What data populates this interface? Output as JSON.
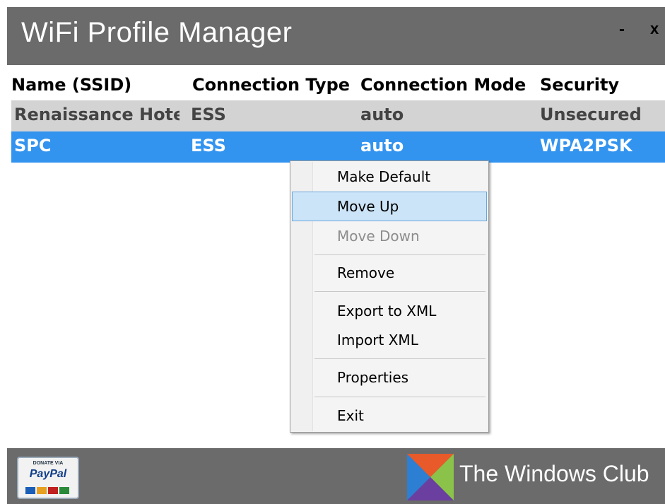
{
  "window": {
    "title": "WiFi Profile Manager",
    "minimize_label": "-",
    "close_label": "x"
  },
  "table": {
    "headers": [
      "Name (SSID)",
      "Connection Type",
      "Connection Mode",
      "Security"
    ],
    "rows": [
      [
        "Renaissance Hotel",
        "ESS",
        "auto",
        "Unsecured"
      ],
      [
        "SPC",
        "ESS",
        "auto",
        "WPA2PSK"
      ]
    ],
    "selected_row": 1
  },
  "context_menu": {
    "items": [
      {
        "label": "Make Default",
        "enabled": true
      },
      {
        "label": "Move Up",
        "enabled": true,
        "highlighted": true
      },
      {
        "label": "Move Down",
        "enabled": false
      },
      {
        "label": "Remove",
        "enabled": true
      },
      {
        "label": "Export to XML",
        "enabled": true
      },
      {
        "label": "Import XML",
        "enabled": true
      },
      {
        "label": "Properties",
        "enabled": true
      },
      {
        "label": "Exit",
        "enabled": true
      }
    ]
  },
  "footer": {
    "paypal_small": "DONATE VIA",
    "paypal_logo": "PayPal",
    "brand_text": "The Windows Club"
  },
  "colors": {
    "titlebar": "#6b6b6b",
    "selected_row": "#3394f0",
    "row_alt": "#d3d3d3",
    "menu_highlight": "#cce4f7"
  }
}
